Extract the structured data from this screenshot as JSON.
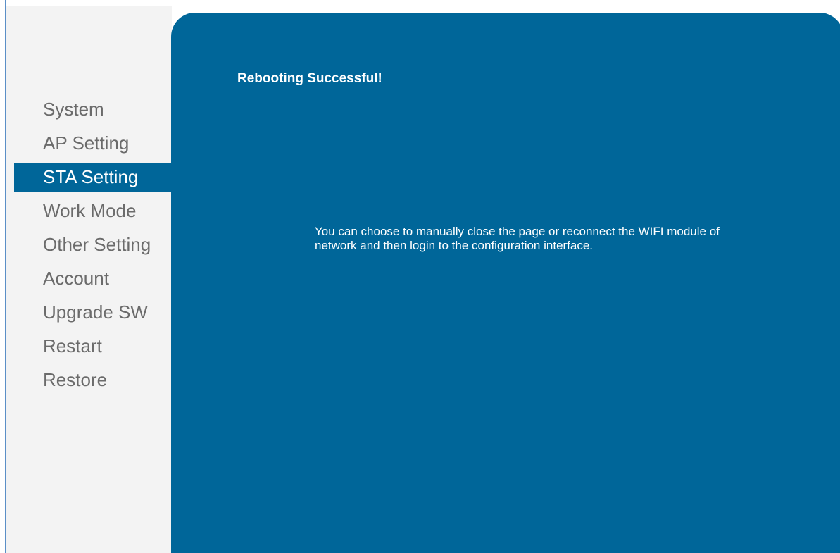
{
  "sidebar": {
    "items": [
      {
        "label": "System"
      },
      {
        "label": "AP Setting"
      },
      {
        "label": "STA Setting"
      },
      {
        "label": "Work Mode"
      },
      {
        "label": "Other Setting"
      },
      {
        "label": "Account"
      },
      {
        "label": "Upgrade SW"
      },
      {
        "label": "Restart"
      },
      {
        "label": "Restore"
      }
    ],
    "active_label": "STA Setting"
  },
  "main": {
    "title": "Rebooting Successful!",
    "message": "You can choose to manually close the page or reconnect the WIFI module of network and then login to the configuration interface."
  },
  "colors": {
    "accent": "#006699",
    "sidebar_bg": "#f3f3f3",
    "nav_text": "#6b6b6b",
    "content_text": "#ffffff"
  }
}
